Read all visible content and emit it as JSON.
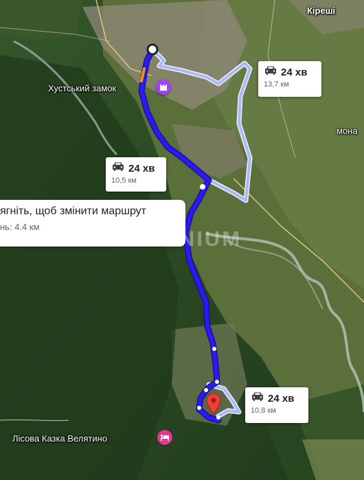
{
  "places": {
    "kireshi": "Кіреші",
    "mona": "мона",
    "khust_castle": "Хустський замок",
    "lisova_kazka": "Лісова Казка Велятино"
  },
  "routes": [
    {
      "time": "24 хв",
      "distance": "13,7 км",
      "variant": "alternative"
    },
    {
      "time": "24 хв",
      "distance": "10,5 км",
      "variant": "selected"
    },
    {
      "time": "24 хв",
      "distance": "10,8 км",
      "variant": "alternative"
    }
  ],
  "tooltip": {
    "main": "ягніть, щоб змінити маршрут",
    "sub": "нь: 4.4 км"
  },
  "watermark": "DOMINIUM",
  "icons": {
    "car": "car-icon",
    "castle": "castle-icon",
    "hotel": "bed-icon",
    "destination": "destination-pin-icon",
    "origin": "origin-dot-icon"
  },
  "colors": {
    "route_selected": "#2a1cf0",
    "route_alternative": "#a8b8ff",
    "poi_castle": "#a142f4",
    "poi_hotel": "#e8358f",
    "destination_pin": "#ea4335"
  }
}
